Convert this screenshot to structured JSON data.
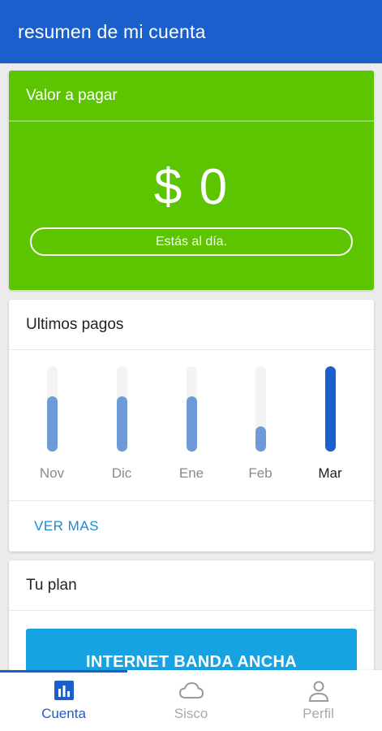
{
  "header": {
    "title": "resumen de mi cuenta"
  },
  "payment": {
    "title": "Valor a pagar",
    "amount": "$ 0",
    "status": "Estás al día."
  },
  "payments_history": {
    "title": "Ultimos pagos",
    "link": "VER MAS",
    "months": [
      {
        "label": "Nov",
        "level": 0.65,
        "active": false
      },
      {
        "label": "Dic",
        "level": 0.65,
        "active": false
      },
      {
        "label": "Ene",
        "level": 0.65,
        "active": false
      },
      {
        "label": "Feb",
        "level": 0.3,
        "active": false
      },
      {
        "label": "Mar",
        "level": 1.0,
        "active": true
      }
    ]
  },
  "plan": {
    "title": "Tu plan",
    "button": "INTERNET BANDA ANCHA"
  },
  "bottom_nav": {
    "items": [
      {
        "label": "Cuenta",
        "icon": "bar-chart-icon",
        "active": true
      },
      {
        "label": "Sisco",
        "icon": "cloud-icon",
        "active": false
      },
      {
        "label": "Perfil",
        "icon": "person-icon",
        "active": false
      }
    ]
  },
  "colors": {
    "primary": "#1a5fcc",
    "success": "#5cc400",
    "plan_button": "#17a3e2",
    "bar_inactive": "#6e9ad8"
  }
}
